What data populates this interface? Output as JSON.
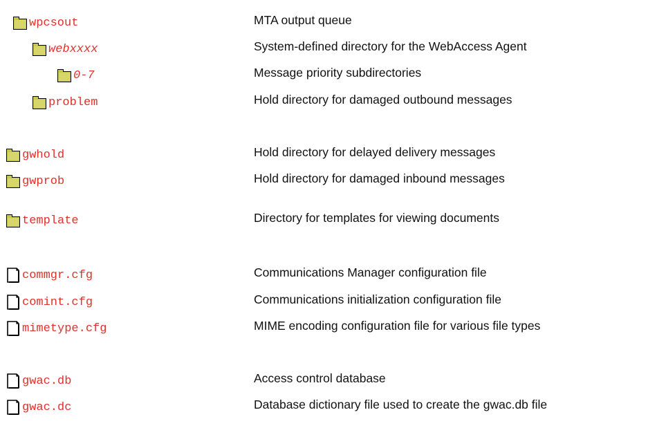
{
  "entries": [
    {
      "name": "wpcsout",
      "type": "folder",
      "italic": false,
      "description": "MTA output queue"
    },
    {
      "name": "webxxxx",
      "type": "folder",
      "italic": true,
      "description": "System-defined directory for the WebAccess Agent"
    },
    {
      "name": "0-7",
      "type": "folder",
      "italic": true,
      "description": "Message priority subdirectories"
    },
    {
      "name": "problem",
      "type": "folder",
      "italic": false,
      "description": "Hold directory for damaged outbound messages"
    },
    {
      "name": "gwhold",
      "type": "folder",
      "italic": false,
      "description": "Hold directory for delayed delivery messages"
    },
    {
      "name": "gwprob",
      "type": "folder",
      "italic": false,
      "description": "Hold directory for damaged inbound messages"
    },
    {
      "name": "template",
      "type": "folder",
      "italic": false,
      "description": "Directory for templates for viewing documents"
    },
    {
      "name": "commgr.cfg",
      "type": "file",
      "italic": false,
      "description": "Communications Manager configuration file"
    },
    {
      "name": "comint.cfg",
      "type": "file",
      "italic": false,
      "description": "Communications initialization configuration file"
    },
    {
      "name": "mimetype.cfg",
      "type": "file",
      "italic": false,
      "description": "MIME encoding configuration file for various file types"
    },
    {
      "name": "gwac.db",
      "type": "file",
      "italic": false,
      "description": "Access control database"
    },
    {
      "name": "gwac.dc",
      "type": "file",
      "italic": false,
      "description": "Database dictionary file used to create the gwac.db file"
    }
  ],
  "colors": {
    "name_text": "#e0302a",
    "description_text": "#111111",
    "folder_fill": "#c8c850",
    "file_outline": "#000000"
  },
  "icons": {
    "folder": "folder-icon",
    "file": "file-icon"
  }
}
